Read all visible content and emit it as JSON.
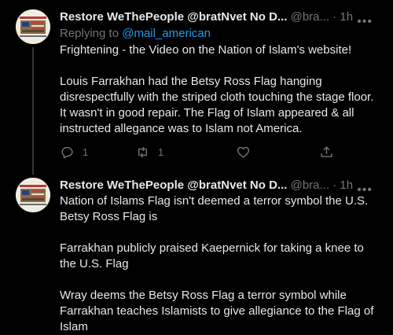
{
  "tweets": [
    {
      "author_name": "Restore WeThePeople @bratNvet No D...",
      "handle": "@bra...",
      "separator": "·",
      "time": "1h",
      "more": "•••",
      "reply_prefix": "Replying to ",
      "reply_to": "@mail_american",
      "paragraphs": [
        "Frightening - the Video on the Nation of Islam's website!",
        "Louis Farrakhan had the Betsy Ross Flag hanging disrespectfully with the striped cloth touching the stage floor. It wasn't in good repair. The Flag of Islam appeared & all instructed allegance was to Islam not America."
      ],
      "replies": "1",
      "retweets": "1"
    },
    {
      "author_name": "Restore WeThePeople @bratNvet No D...",
      "handle": "@bra...",
      "separator": "·",
      "time": "1h",
      "more": "•••",
      "paragraphs": [
        "Nation of Islams Flag isn't deemed a terror symbol the U.S. Betsy Ross Flag is",
        "Farrakhan publicly praised Kaepernick for taking a knee to the U.S. Flag",
        "Wray deems the Betsy Ross Flag a terror symbol while Farrakhan teaches Islamists to give allegiance to the Flag of Islam"
      ]
    }
  ],
  "icons": {
    "reply": "reply-icon",
    "retweet": "retweet-icon",
    "like": "heart-icon",
    "share": "share-icon",
    "more": "more-icon"
  },
  "colors": {
    "background": "#000000",
    "text": "#e7e9ea",
    "muted": "#71767b",
    "link": "#1d9bf0"
  }
}
